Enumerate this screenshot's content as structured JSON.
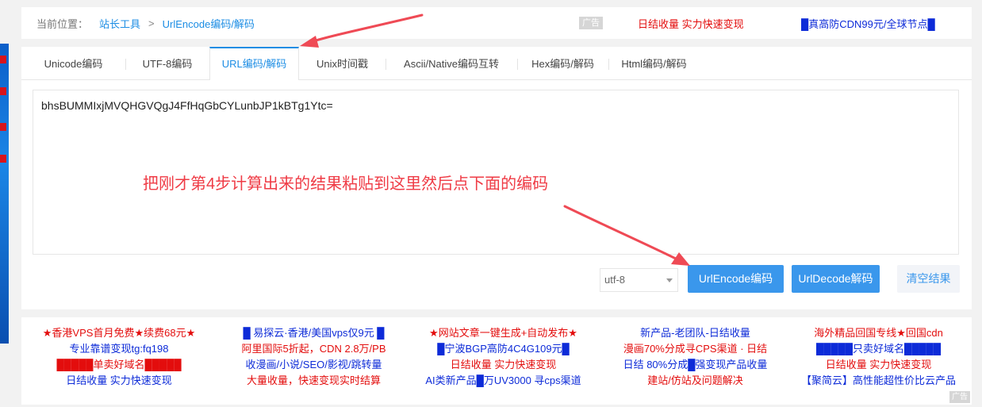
{
  "breadcrumb": {
    "prefix": "当前位置：",
    "items": [
      "站长工具",
      "UrlEncode编码/解码"
    ],
    "separator": ">"
  },
  "top_ads": {
    "tag": "广告",
    "link1": "日结收量 实力快速变现",
    "link2": "█真高防CDN99元/全球节点█"
  },
  "tabs": [
    {
      "label": "Unicode编码"
    },
    {
      "label": "UTF-8编码"
    },
    {
      "label": "URL编码/解码",
      "active": true
    },
    {
      "label": "Unix时间戳"
    },
    {
      "label": "Ascii/Native编码互转"
    },
    {
      "label": "Hex编码/解码"
    },
    {
      "label": "Html编码/解码"
    }
  ],
  "editor": {
    "value": "bhsBUMMIxjMVQHGVQgJ4FfHqGbCYLunbJP1kBTg1Ytc=",
    "annotation": "把刚才第4步计算出来的结果粘贴到这里然后点下面的编码"
  },
  "controls": {
    "charset": "utf-8",
    "encode_label": "UrlEncode编码",
    "decode_label": "UrlDecode解码",
    "clear_label": "清空结果"
  },
  "bottom_ads": {
    "corner_tag": "广告",
    "columns": [
      [
        "★香港VPS首月免费★续费68元★",
        "专业靠谱变现tg:fq198",
        "█████单卖好域名█████",
        "日结收量 实力快速变现"
      ],
      [
        "█ 易探云·香港/美国vps仅9元 █",
        "阿里国际5折起，CDN 2.8万/PB",
        "收漫画/小说/SEO/影视/跳转量",
        "大量收量，快速变现实时结算"
      ],
      [
        "★网站文章一键生成+自动发布★",
        "█宁波BGP高防4C4G109元█",
        "日结收量 实力快速变现",
        "AI类新产品█万UV3000 寻cps渠道"
      ],
      [
        "新产品-老团队-日结收量",
        "漫画70%分成寻CPS渠道 · 日结",
        "日结 80%分成█强变现产品收量",
        "建站/仿站及问题解决"
      ],
      [
        "海外精品回国专线★回国cdn",
        "█████只卖好域名█████",
        "日结收量 实力快速变现",
        "【聚简云】高性能超性价比云产品"
      ]
    ],
    "column_colors": [
      [
        "#e30d0d",
        "#0d2bd8",
        "#e30d0d",
        "#0d2bd8"
      ],
      [
        "#0d2bd8",
        "#e30d0d",
        "#0d2bd8",
        "#e30d0d"
      ],
      [
        "#e30d0d",
        "#0d2bd8",
        "#e30d0d",
        "#0d2bd8"
      ],
      [
        "#0d2bd8",
        "#e30d0d",
        "#0d2bd8",
        "#e30d0d"
      ],
      [
        "#e30d0d",
        "#0d2bd8",
        "#e30d0d",
        "#0d2bd8"
      ]
    ]
  },
  "colors": {
    "accent": "#1c8de4",
    "button": "#3a97ec",
    "annotation": "#ef3b45"
  }
}
